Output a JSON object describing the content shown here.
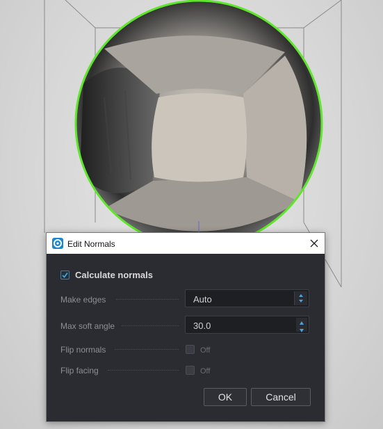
{
  "dialog": {
    "title": "Edit Normals",
    "icon": "app-logo-icon",
    "close_icon": "close-icon"
  },
  "calculate_normals": {
    "label": "Calculate normals",
    "checked": true
  },
  "make_edges": {
    "label": "Make edges",
    "value": "Auto"
  },
  "max_soft_angle": {
    "label": "Max soft angle",
    "value": "30.0"
  },
  "flip_normals": {
    "label": "Flip normals",
    "checked": false,
    "state": "Off"
  },
  "flip_facing": {
    "label": "Flip facing",
    "checked": false,
    "state": "Off"
  },
  "buttons": {
    "ok": "OK",
    "cancel": "Cancel"
  },
  "colors": {
    "dialog_bg": "#2b2c31",
    "accent": "#3f8fd0",
    "selection_outline": "#5ee62b"
  }
}
